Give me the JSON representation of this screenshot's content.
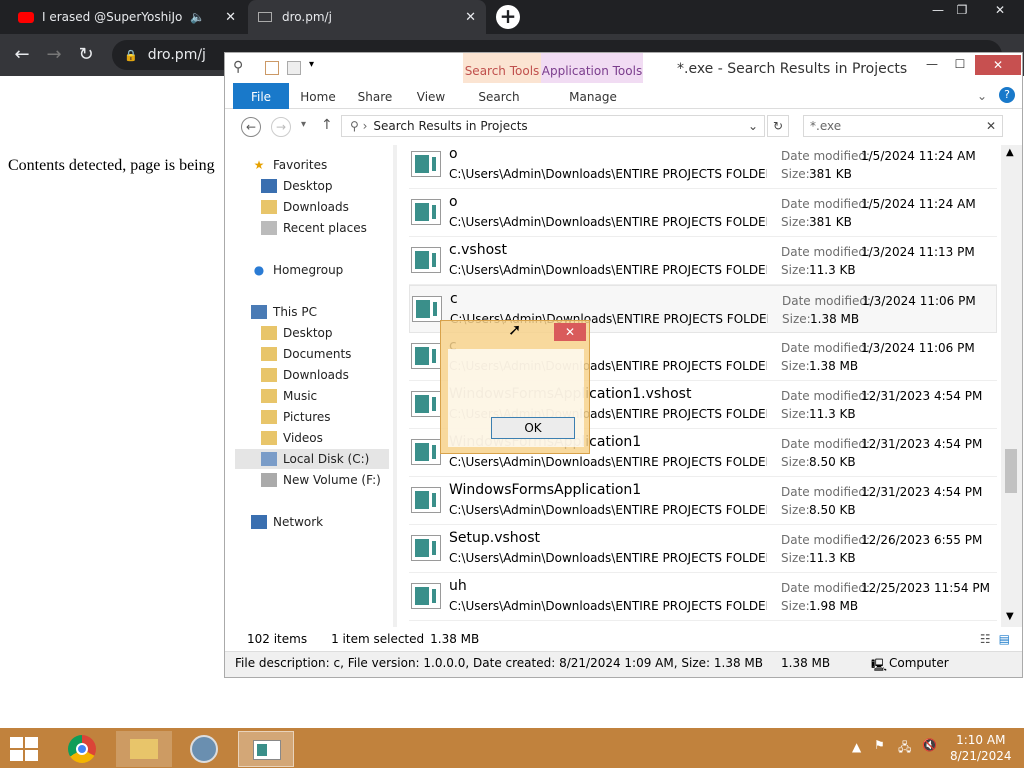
{
  "chrome": {
    "tabs": [
      {
        "label": "I erased @SuperYoshiJonty !"
      },
      {
        "label": "dro.pm/j"
      }
    ],
    "url": "dro.pm/j"
  },
  "page": {
    "text": "Contents detected, page is being"
  },
  "explorer": {
    "title": "*.exe - Search Results in Projects",
    "context_tabs": [
      "Search Tools",
      "Application Tools"
    ],
    "ribbon_tabs": [
      "File",
      "Home",
      "Share",
      "View",
      "Search",
      "Manage"
    ],
    "address": "Search Results in Projects",
    "search_query": "*.exe",
    "nav": {
      "favorites": "Favorites",
      "desktop": "Desktop",
      "downloads": "Downloads",
      "recent": "Recent places",
      "homegroup": "Homegroup",
      "thispc": "This PC",
      "pc_desktop": "Desktop",
      "documents": "Documents",
      "pc_downloads": "Downloads",
      "music": "Music",
      "pictures": "Pictures",
      "videos": "Videos",
      "localdisk": "Local Disk (C:)",
      "newvolume": "New Volume (F:)",
      "network": "Network"
    },
    "labels": {
      "date_modified": "Date modified:",
      "size": "Size:"
    },
    "files": [
      {
        "name": "o",
        "path": "C:\\Users\\Admin\\Downloads\\ENTIRE PROJECTS FOLDER\\P...",
        "date": "1/5/2024 11:24 AM",
        "size": "381 KB"
      },
      {
        "name": "o",
        "path": "C:\\Users\\Admin\\Downloads\\ENTIRE PROJECTS FOLDER\\P...",
        "date": "1/5/2024 11:24 AM",
        "size": "381 KB"
      },
      {
        "name": "c.vshost",
        "path": "C:\\Users\\Admin\\Downloads\\ENTIRE PROJECTS FOLDER\\P...",
        "date": "1/3/2024 11:13 PM",
        "size": "11.3 KB"
      },
      {
        "name": "c",
        "path": "C:\\Users\\Admin\\Downloads\\ENTIRE PROJECTS FOLDER\\P...",
        "date": "1/3/2024 11:06 PM",
        "size": "1.38 MB"
      },
      {
        "name": "c",
        "path": "C:\\Users\\Admin\\Downloads\\ENTIRE PROJECTS FOLDER\\P...",
        "date": "1/3/2024 11:06 PM",
        "size": "1.38 MB"
      },
      {
        "name": "WindowsFormsApplication1.vshost",
        "path": "C:\\Users\\Admin\\Downloads\\ENTIRE PROJECTS FOLDER\\P...",
        "date": "12/31/2023 4:54 PM",
        "size": "11.3 KB"
      },
      {
        "name": "WindowsFormsApplication1",
        "path": "C:\\Users\\Admin\\Downloads\\ENTIRE PROJECTS FOLDER\\P...",
        "date": "12/31/2023 4:54 PM",
        "size": "8.50 KB"
      },
      {
        "name": "WindowsFormsApplication1",
        "path": "C:\\Users\\Admin\\Downloads\\ENTIRE PROJECTS FOLDER\\P...",
        "date": "12/31/2023 4:54 PM",
        "size": "8.50 KB"
      },
      {
        "name": "Setup.vshost",
        "path": "C:\\Users\\Admin\\Downloads\\ENTIRE PROJECTS FOLDER\\P...",
        "date": "12/26/2023 6:55 PM",
        "size": "11.3 KB"
      },
      {
        "name": "uh",
        "path": "C:\\Users\\Admin\\Downloads\\ENTIRE PROJECTS FOLDER\\P...",
        "date": "12/25/2023 11:54 PM",
        "size": "1.98 MB"
      }
    ],
    "status": {
      "items": "102 items",
      "selected": "1 item selected",
      "selected_size": "1.38 MB"
    },
    "details": {
      "description": "File description: c, File version: 1.0.0.0, Date created: 8/21/2024 1:09 AM, Size: 1.38 MB",
      "size": "1.38 MB",
      "location": "Computer"
    }
  },
  "dialog": {
    "ok": "OK"
  },
  "taskbar": {
    "time": "1:10 AM",
    "date": "8/21/2024"
  }
}
